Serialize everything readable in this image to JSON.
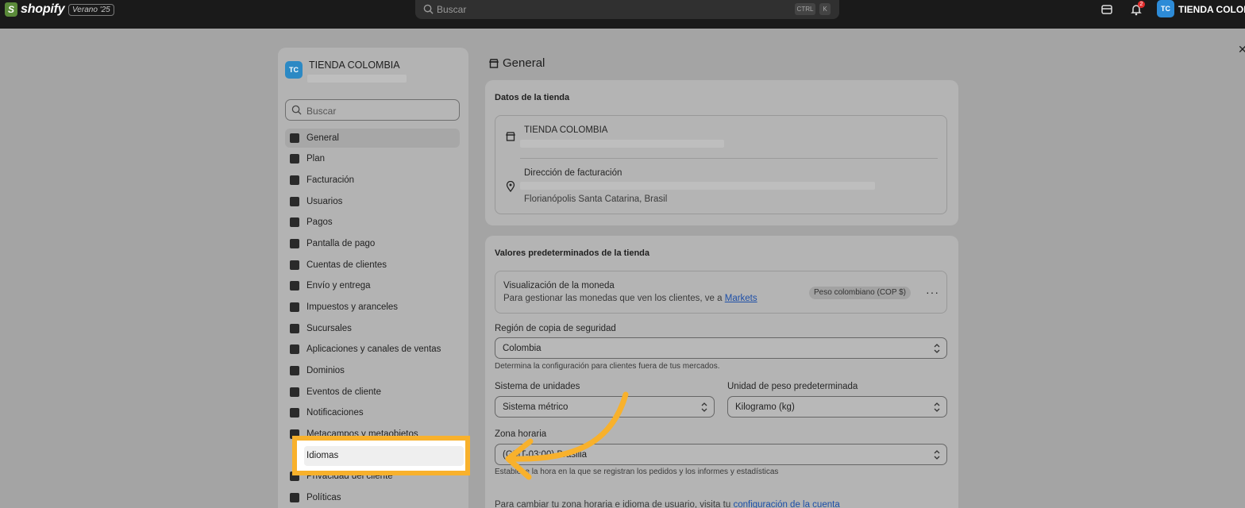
{
  "topbar": {
    "logo_text": "shopify",
    "edition": "Verano '25",
    "search_placeholder": "Buscar",
    "shortcut_ctrl": "CTRL",
    "shortcut_k": "K",
    "notification_count": "2",
    "avatar_initials": "TC",
    "store_name": "TIENDA COLOMBIA"
  },
  "sidebar": {
    "avatar_initials": "TC",
    "store_name": "TIENDA COLOMBIA",
    "search_placeholder": "Buscar",
    "items": [
      {
        "label": "General"
      },
      {
        "label": "Plan"
      },
      {
        "label": "Facturación"
      },
      {
        "label": "Usuarios"
      },
      {
        "label": "Pagos"
      },
      {
        "label": "Pantalla de pago"
      },
      {
        "label": "Cuentas de clientes"
      },
      {
        "label": "Envío y entrega"
      },
      {
        "label": "Impuestos y aranceles"
      },
      {
        "label": "Sucursales"
      },
      {
        "label": "Aplicaciones y canales de ventas"
      },
      {
        "label": "Dominios"
      },
      {
        "label": "Eventos de cliente"
      },
      {
        "label": "Notificaciones"
      },
      {
        "label": "Metacampos y metaobjetos"
      },
      {
        "label": "Idiomas"
      },
      {
        "label": "Privacidad del cliente"
      },
      {
        "label": "Políticas"
      }
    ]
  },
  "main": {
    "title": "General",
    "store_card": {
      "title": "Datos de la tienda",
      "store_name": "TIENDA COLOMBIA",
      "billing_label": "Dirección de facturación",
      "billing_city": "Florianópolis Santa Catarina, Brasil"
    },
    "defaults_card": {
      "title": "Valores predeterminados de la tienda",
      "currency_label": "Visualización de la moneda",
      "currency_help": "Para gestionar las monedas que ven los clientes, ve a",
      "currency_link": "Markets",
      "currency_badge": "Peso colombiano (COP $)",
      "backup_label": "Región de copia de seguridad",
      "backup_value": "Colombia",
      "backup_help": "Determina la configuración para clientes fuera de tus mercados.",
      "units_label": "Sistema de unidades",
      "units_value": "Sistema métrico",
      "weight_label": "Unidad de peso predeterminada",
      "weight_value": "Kilogramo (kg)",
      "tz_label": "Zona horaria",
      "tz_value": "(GMT-03:00) Brasilia",
      "tz_help": "Establece la hora en la que se registran los pedidos y los informes y estadísticas",
      "footer_text": "Para cambiar tu zona horaria e idioma de usuario, visita tu",
      "footer_link": "configuración de la cuenta"
    }
  },
  "colors": {
    "highlight": "#f8b12c",
    "topbar": "#1a1a1a",
    "avatar": "#2d8bd7"
  }
}
